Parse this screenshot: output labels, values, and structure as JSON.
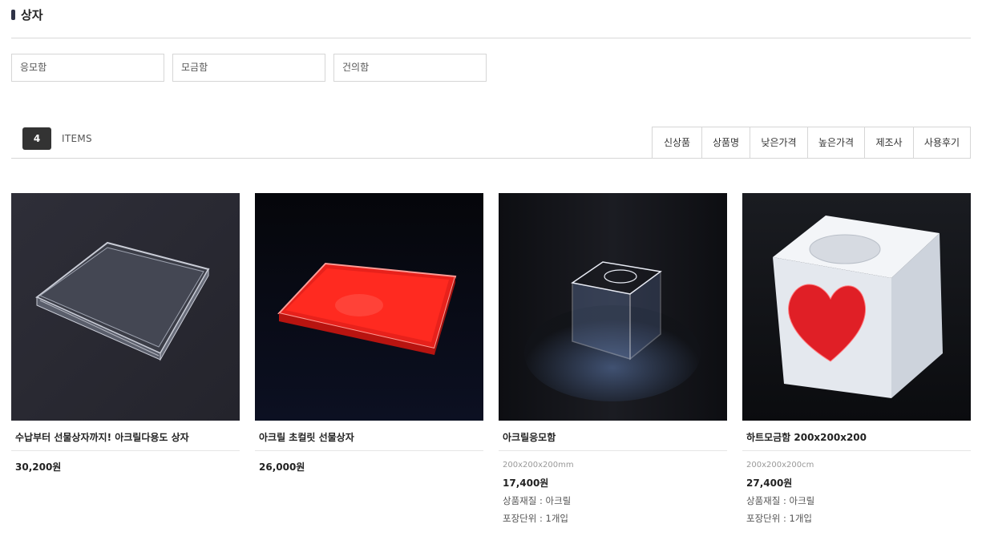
{
  "page_title": "상자",
  "subcategories": [
    "응모함",
    "모금함",
    "건의함"
  ],
  "count": "4",
  "items_label": "ITEMS",
  "sort_options": [
    "신상품",
    "상품명",
    "낮은가격",
    "높은가격",
    "제조사",
    "사용후기"
  ],
  "products": [
    {
      "name": "수납부터 선물상자까지! 아크릴다용도 상자",
      "spec": "",
      "price": "30,200원",
      "material": "",
      "unit": "",
      "image": "clear-acrylic-tray"
    },
    {
      "name": "아크릴 초컬릿 선물상자",
      "spec": "",
      "price": "26,000원",
      "material": "",
      "unit": "",
      "image": "red-acrylic-box"
    },
    {
      "name": "아크릴응모함",
      "spec": "200x200x200mm",
      "price": "17,400원",
      "material": "상품재질 : 아크릴",
      "unit": "포장단위 : 1개입",
      "image": "clear-acrylic-cube"
    },
    {
      "name": "하트모금함 200x200x200",
      "spec": "200x200x200cm",
      "price": "27,400원",
      "material": "상품재질 : 아크릴",
      "unit": "포장단위 : 1개입",
      "image": "white-heart-box"
    }
  ]
}
